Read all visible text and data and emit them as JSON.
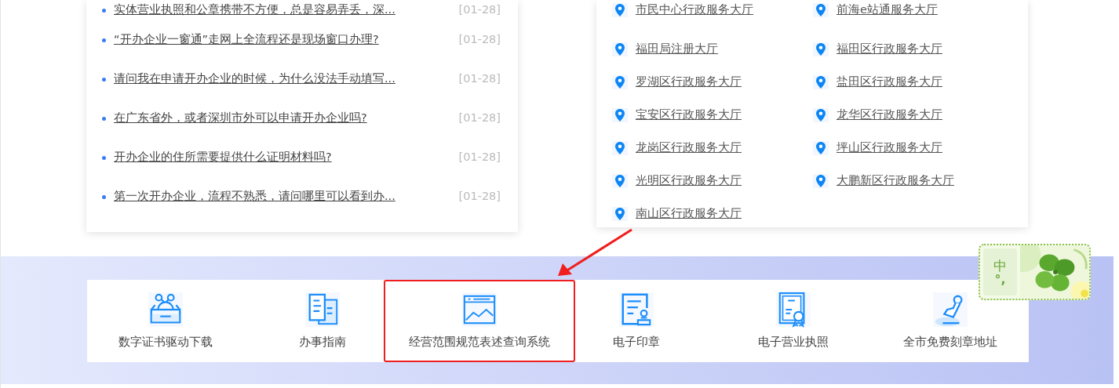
{
  "questions": [
    {
      "text": "实体营业执照和公章携带不方便，总是容易弄丢，深...",
      "date": "[01-28]"
    },
    {
      "text": "“开办企业一窗通”走网上全流程还是现场窗口办理?",
      "date": "[01-28]"
    },
    {
      "text": "请问我在申请开办企业的时候，为什么没法手动填写...",
      "date": "[01-28]"
    },
    {
      "text": "在广东省外，或者深圳市外可以申请开办企业吗?",
      "date": "[01-28]"
    },
    {
      "text": "开办企业的住所需要提供什么证明材料吗?",
      "date": "[01-28]"
    },
    {
      "text": "第一次开办企业，流程不熟悉，请问哪里可以看到办...",
      "date": "[01-28]"
    }
  ],
  "service_halls": [
    "市民中心行政服务大厅",
    "前海e站通服务大厅",
    "福田局注册大厅",
    "福田区行政服务大厅",
    "罗湖区行政服务大厅",
    "盐田区行政服务大厅",
    "宝安区行政服务大厅",
    "龙华区行政服务大厅",
    "龙岗区行政服务大厅",
    "坪山区行政服务大厅",
    "光明区行政服务大厅",
    "大鹏新区行政服务大厅",
    "南山区行政服务大厅"
  ],
  "shortcuts": [
    {
      "label": "数字证书驱动下载",
      "kind": "driver",
      "highlighted": false
    },
    {
      "label": "办事指南",
      "kind": "guide",
      "highlighted": false
    },
    {
      "label": "经营范围规范表述查询系统",
      "kind": "scope",
      "highlighted": true
    },
    {
      "label": "电子印章",
      "kind": "seal",
      "highlighted": false
    },
    {
      "label": "电子营业执照",
      "kind": "license",
      "highlighted": false
    },
    {
      "label": "全市免费刻章地址",
      "kind": "engraving",
      "highlighted": false
    }
  ],
  "ime": {
    "mode": "中",
    "punctuation": "°,"
  }
}
